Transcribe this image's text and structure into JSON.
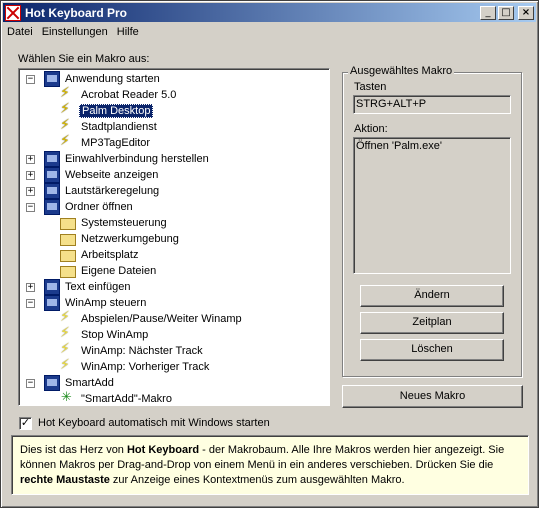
{
  "window": {
    "title": "Hot Keyboard Pro",
    "controls": [
      "_",
      "□",
      "×"
    ]
  },
  "menu": [
    "Datei",
    "Einstellungen",
    "Hilfe"
  ],
  "tree_label": "Wählen Sie ein Makro aus:",
  "tree": [
    {
      "label": "Anwendung starten",
      "icon": "keyboard-icon",
      "expander": "−",
      "level": 0
    },
    {
      "label": "Acrobat Reader 5.0",
      "icon": "lightning-icon",
      "level": 1
    },
    {
      "label": "Palm Desktop",
      "icon": "lightning-icon",
      "level": 1,
      "selected": true
    },
    {
      "label": "Stadtplandienst",
      "icon": "lightning-icon",
      "level": 1
    },
    {
      "label": "MP3TagEditor",
      "icon": "lightning-icon",
      "level": 1
    },
    {
      "label": "Einwahlverbindung herstellen",
      "icon": "keyboard-icon",
      "expander": "+",
      "level": 0
    },
    {
      "label": "Webseite anzeigen",
      "icon": "keyboard-icon",
      "expander": "+",
      "level": 0
    },
    {
      "label": "Lautstärkeregelung",
      "icon": "keyboard-icon",
      "expander": "+",
      "level": 0
    },
    {
      "label": "Ordner öffnen",
      "icon": "keyboard-icon",
      "expander": "−",
      "level": 0
    },
    {
      "label": "Systemsteuerung",
      "icon": "folder-icon",
      "level": 1
    },
    {
      "label": "Netzwerkumgebung",
      "icon": "folder-icon",
      "level": 1
    },
    {
      "label": "Arbeitsplatz",
      "icon": "folder-icon",
      "level": 1
    },
    {
      "label": "Eigene Dateien",
      "icon": "folder-icon",
      "level": 1
    },
    {
      "label": "Text einfügen",
      "icon": "keyboard-icon",
      "expander": "+",
      "level": 0
    },
    {
      "label": "WinAmp steuern",
      "icon": "keyboard-icon",
      "expander": "−",
      "level": 0
    },
    {
      "label": "Abspielen/Pause/Weiter Winamp",
      "icon": "winamp-icon",
      "level": 1
    },
    {
      "label": "Stop WinAmp",
      "icon": "winamp-icon",
      "level": 1
    },
    {
      "label": "WinAmp: Nächster Track",
      "icon": "winamp-icon",
      "level": 1
    },
    {
      "label": "WinAmp: Vorheriger Track",
      "icon": "winamp-icon",
      "level": 1
    },
    {
      "label": "SmartAdd",
      "icon": "keyboard-icon",
      "expander": "−",
      "level": 0
    },
    {
      "label": "\"SmartAdd\"-Makro",
      "icon": "smartadd-icon",
      "level": 1
    }
  ],
  "macro_panel": {
    "group_title": "Ausgewähltes Makro",
    "keys_label": "Tasten",
    "keys_value": "STRG+ALT+P",
    "action_label": "Aktion:",
    "action_value": "Öffnen 'Palm.exe'"
  },
  "buttons": {
    "edit": "Ändern",
    "schedule": "Zeitplan",
    "delete": "Löschen",
    "new_macro": "Neues Makro"
  },
  "autostart": {
    "label": "Hot Keyboard automatisch mit Windows starten",
    "checked": "✓"
  },
  "info": {
    "p1": "Dies ist das Herz von ",
    "b1": "Hot Keyboard",
    "p2": " - der Makrobaum. Alle Ihre Makros werden hier angezeigt. Sie können Makros per Drag-and-Drop von einem Menü in ein anderes verschieben. Drücken Sie die ",
    "b2": "rechte Maustaste",
    "p3": " zur Anzeige eines Kontextmenüs zum ausgewählten Makro."
  }
}
